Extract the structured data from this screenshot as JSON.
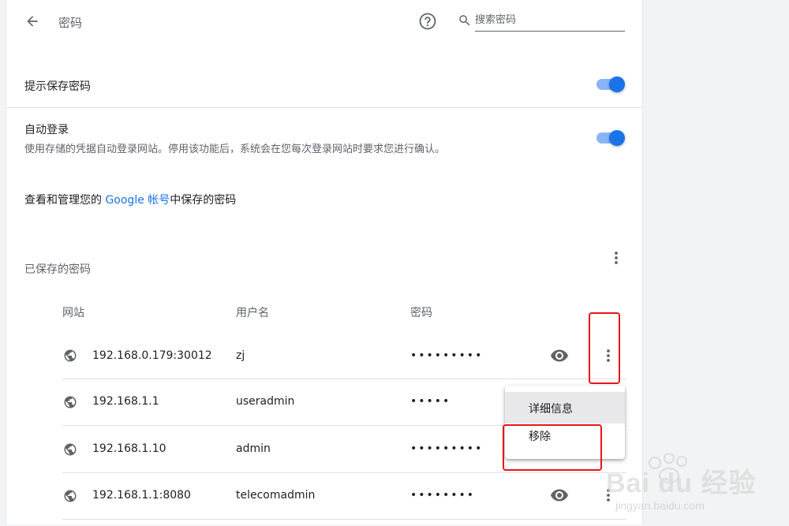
{
  "header": {
    "title": "密码",
    "search_placeholder": "搜索密码"
  },
  "settings": {
    "offer_save": {
      "label": "提示保存密码",
      "enabled": true
    },
    "auto_signin": {
      "label": "自动登录",
      "description": "使用存储的凭据自动登录网站。停用该功能后，系统会在您每次登录网站时要求您进行确认。",
      "enabled": true
    },
    "google_account": {
      "prefix": "查看和管理您的 ",
      "link": "Google 帐号",
      "suffix": "中保存的密码"
    }
  },
  "saved": {
    "title": "已保存的密码",
    "columns": [
      "网站",
      "用户名",
      "密码"
    ],
    "rows": [
      {
        "site": "192.168.0.179:30012",
        "user": "zj",
        "password": "•••••••••"
      },
      {
        "site": "192.168.1.1",
        "user": "useradmin",
        "password": "•••••"
      },
      {
        "site": "192.168.1.10",
        "user": "admin",
        "password": "•••••••••"
      },
      {
        "site": "192.168.1.1:8080",
        "user": "telecomadmin",
        "password": "••••••••"
      }
    ]
  },
  "menu": {
    "details": "详细信息",
    "remove": "移除"
  },
  "watermark": {
    "brand": "Bai du 经验",
    "url": "jingyan.baidu.com"
  },
  "colors": {
    "accent": "#1a73e8",
    "toggle_track": "#8ab4f8",
    "highlight": "#e8151b"
  }
}
